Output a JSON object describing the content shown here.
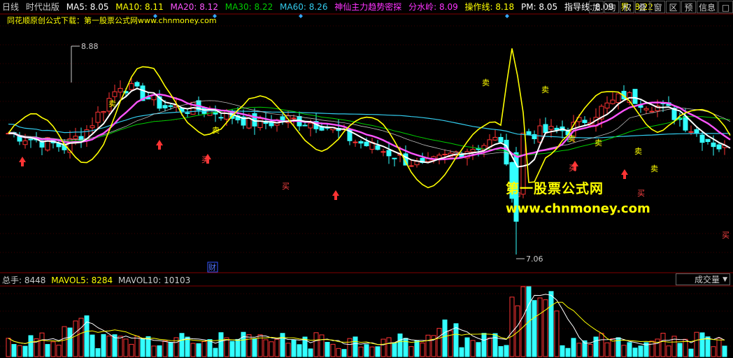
{
  "header": {
    "period": "日线",
    "version": "时代出版",
    "ma5": "MA5: 8.05",
    "ma10": "MA10: 8.11",
    "ma20": "MA20: 8.12",
    "ma30": "MA30: 8.22",
    "ma60": "MA60: 8.26",
    "indicator": "神仙主力趋势密探",
    "fenshuiling": "分水岭: 8.09",
    "caozuo": "操作线: 8.18",
    "pm": "PM: 8.05",
    "zhidao": "指导线: 8.09",
    "jie": "界: 8.22"
  },
  "toolbar": [
    "加",
    "均",
    "权",
    "叠",
    "窗",
    "区",
    "预",
    "信息",
    "□"
  ],
  "subline": "同花顺原创公式下载：第一股票公式网www.chnmoney.com",
  "annotations": {
    "high": "8.88",
    "low": "7.06",
    "cai": "财"
  },
  "signals": {
    "buy": "买",
    "sell": "卖"
  },
  "watermark": {
    "line1": "第一股票公式网",
    "line2": "www.chnmoney.com"
  },
  "volume": {
    "zongshou": "总手: 8448",
    "mavol5": "MAVOL5: 8284",
    "mavol10": "MAVOL10: 10103",
    "selector": "成交量"
  },
  "colors": {
    "ma5": "#ffffff",
    "ma10": "#ffff00",
    "ma20": "#ff55ff",
    "ma30": "#00cc00",
    "ma60": "#33ccee",
    "up": "#ff3333",
    "down": "#33ffff",
    "indicator": "#ff33ff"
  },
  "chart_data": {
    "type": "candlestick",
    "high_marker": 8.88,
    "low_marker": 7.06,
    "ma": {
      "MA5": 8.05,
      "MA10": 8.11,
      "MA20": 8.12,
      "MA30": 8.22,
      "MA60": 8.26
    },
    "volume": {
      "total": 8448,
      "MAVOL5": 8284,
      "MAVOL10": 10103
    }
  }
}
